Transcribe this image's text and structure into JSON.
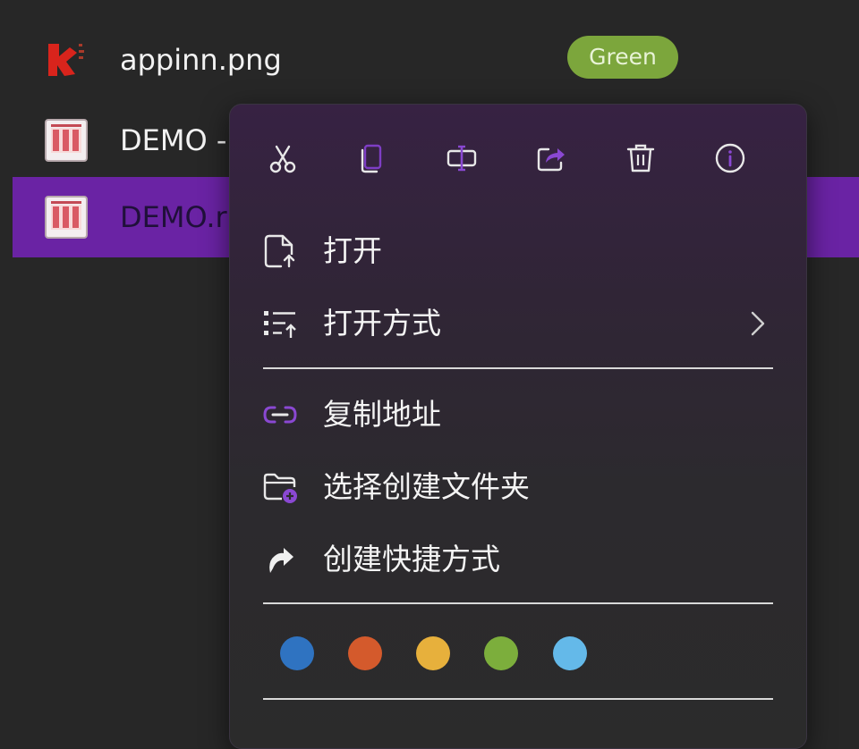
{
  "files": [
    {
      "name": "appinn.png",
      "icon": "appinn-logo-icon",
      "tag": "Green",
      "tag_color": "#7ca63c"
    },
    {
      "name": "DEMO - ",
      "icon": "image-thumbnail-icon"
    },
    {
      "name": "DEMO.r",
      "icon": "image-thumbnail-icon",
      "selected": true
    }
  ],
  "context_menu": {
    "toolbar": [
      {
        "icon": "cut-icon"
      },
      {
        "icon": "copy-icon"
      },
      {
        "icon": "rename-icon"
      },
      {
        "icon": "share-icon"
      },
      {
        "icon": "delete-icon"
      },
      {
        "icon": "info-icon"
      }
    ],
    "items": {
      "open": {
        "label": "打开",
        "icon": "open-file-icon"
      },
      "open_with": {
        "label": "打开方式",
        "icon": "open-with-icon",
        "submenu": true
      },
      "copy_path": {
        "label": "复制地址",
        "icon": "link-icon"
      },
      "new_folder": {
        "label": "选择创建文件夹",
        "icon": "new-folder-icon"
      },
      "shortcut": {
        "label": "创建快捷方式",
        "icon": "shortcut-icon"
      }
    },
    "colors": [
      "#2f73c1",
      "#d45a2c",
      "#e7b03c",
      "#7cae3c",
      "#64b9e9"
    ]
  },
  "accent_color": "#6a23a4"
}
